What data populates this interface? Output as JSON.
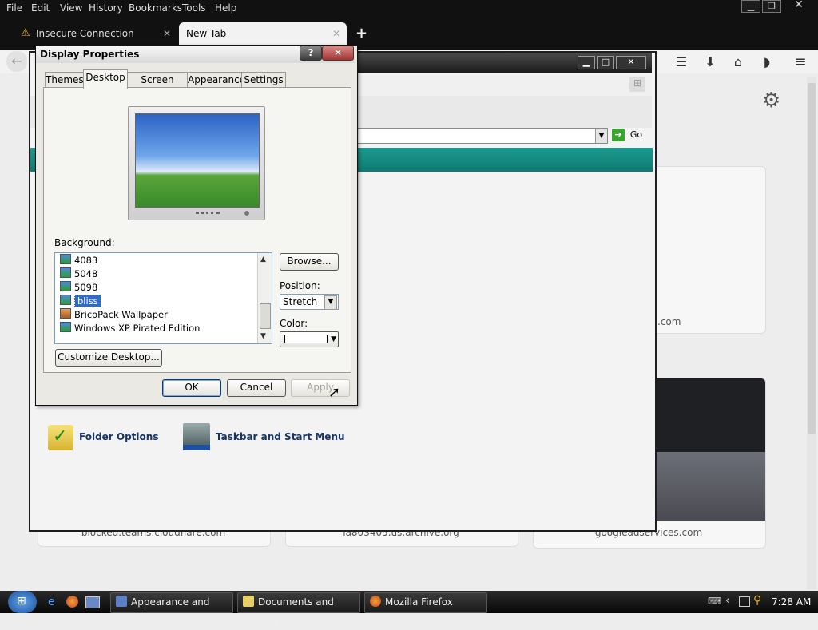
{
  "firefox": {
    "menu": [
      "File",
      "Edit",
      "View",
      "History",
      "Bookmarks",
      "Tools",
      "Help"
    ],
    "tabs": [
      {
        "label": "Insecure Connection"
      },
      {
        "label": "New Tab"
      }
    ],
    "new_tab_symbol": "+",
    "tiles": [
      {
        "label": ".com"
      },
      {
        "label": "blocked.teams.cloudflare.com"
      },
      {
        "label": "ia803405.us.archive.org"
      },
      {
        "label": "googleadservices.com"
      }
    ]
  },
  "control_panel": {
    "go_label": "Go",
    "items": [
      {
        "label": "Folder Options"
      },
      {
        "label": "Taskbar and Start Menu"
      }
    ]
  },
  "dialog": {
    "title": "Display Properties",
    "tabs": [
      "Themes",
      "Desktop",
      "Screen Saver",
      "Appearance",
      "Settings"
    ],
    "active_tab": "Desktop",
    "background_label": "Background:",
    "backgrounds": [
      "4083",
      "5048",
      "5098",
      "bliss",
      "BricoPack Wallpaper",
      "Windows XP Pirated Edition"
    ],
    "selected_background": "bliss",
    "browse_label": "Browse...",
    "position_label": "Position:",
    "position_value": "Stretch",
    "color_label": "Color:",
    "customize_label": "Customize Desktop...",
    "ok_label": "OK",
    "cancel_label": "Cancel",
    "apply_label": "Apply"
  },
  "taskbar": {
    "items": [
      {
        "label": "Appearance and Themes"
      },
      {
        "label": "Documents and Settings"
      },
      {
        "label": "Mozilla Firefox"
      }
    ],
    "clock": "7:28 AM"
  }
}
